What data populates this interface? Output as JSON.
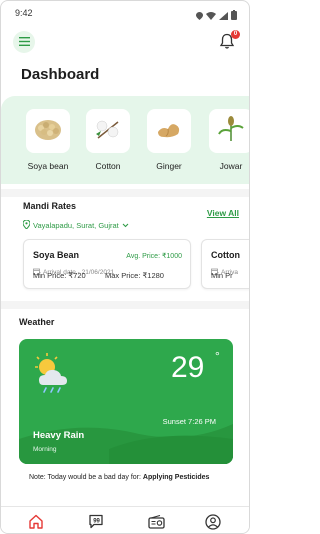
{
  "status_bar": {
    "time": "9:42"
  },
  "header": {
    "title": "Dashboard",
    "notification_count": "0"
  },
  "crops": [
    {
      "name": "Soya bean",
      "icon": "soya-bean-icon"
    },
    {
      "name": "Cotton",
      "icon": "cotton-icon"
    },
    {
      "name": "Ginger",
      "icon": "ginger-icon"
    },
    {
      "name": "Jowar",
      "icon": "jowar-icon"
    }
  ],
  "mandi": {
    "title": "Mandi Rates",
    "view_all": "View All",
    "location": "Vayalapadu, Surat, Gujrat",
    "cards": [
      {
        "crop": "Soya Bean",
        "avg_price": "Avg. Price: ₹1000",
        "arrival": "Arrival date - 21/06/2021",
        "min_price": "Min Price: ₹720",
        "max_price": "Max Price: ₹1280"
      },
      {
        "crop": "Cotton",
        "arrival": "Arriva",
        "min_price": "Min Pr"
      }
    ]
  },
  "weather": {
    "title": "Weather",
    "temperature": "29",
    "degree": "°",
    "sunset": "Sunset 7:26 PM",
    "condition": "Heavy Rain",
    "time_of_day": "Morning",
    "note_prefix": "Note: Today would be a bad day for: ",
    "note_activity": "Applying Pesticides"
  },
  "colors": {
    "accent": "#2e9b46",
    "weather_card": "#2ea84c",
    "crop_panel": "#e5f6ea",
    "badge": "#e53935"
  }
}
